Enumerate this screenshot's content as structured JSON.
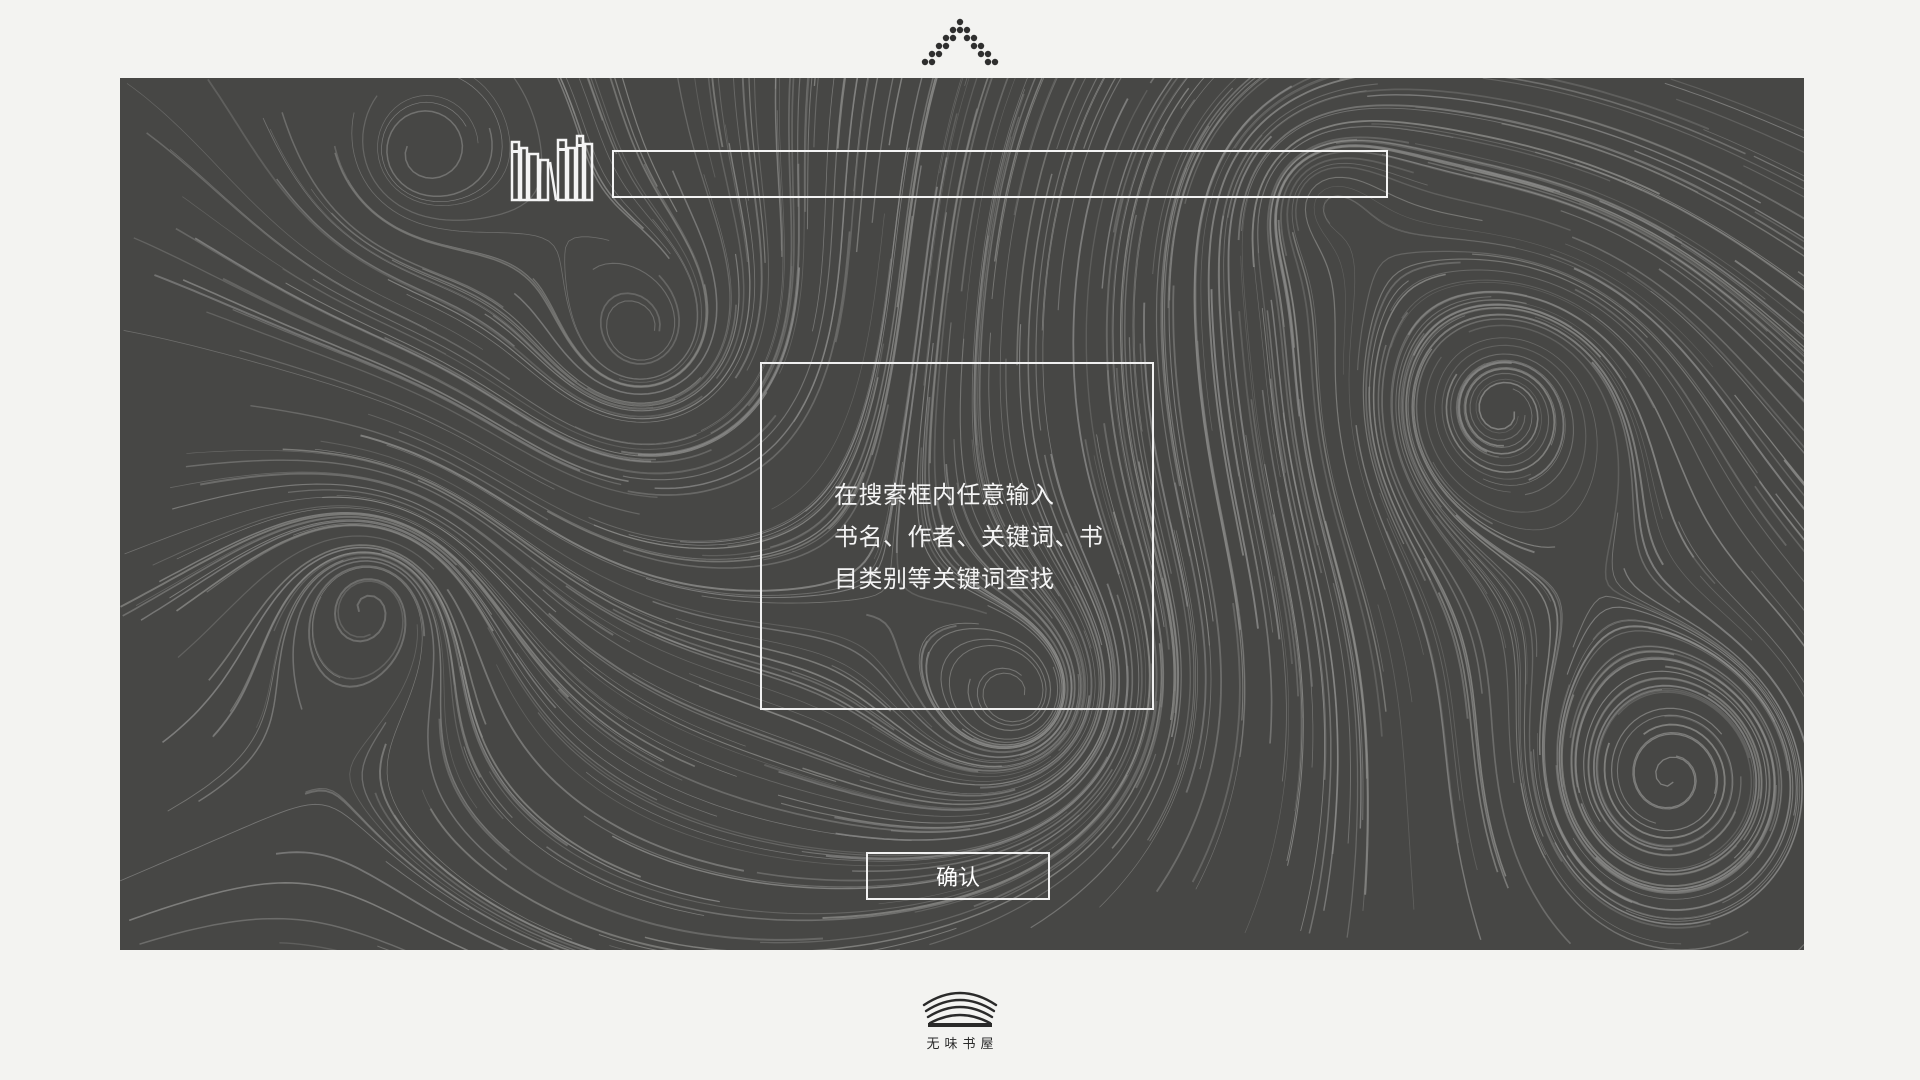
{
  "top_mark": {
    "icon": "dotted-chevron-icon",
    "color": "#2f2f2f"
  },
  "panel": {
    "background": "#474745",
    "line_color": "#8a8a88"
  },
  "search": {
    "icon": "bookshelf-icon",
    "value": "",
    "placeholder": ""
  },
  "hint": {
    "lines": [
      "在搜索框内任意输入",
      "书名、作者、关键词、书",
      "目类别等关键词查找"
    ]
  },
  "confirm_label": "确认",
  "brand": {
    "icon": "layered-roof-icon",
    "name": "无味书屋"
  }
}
